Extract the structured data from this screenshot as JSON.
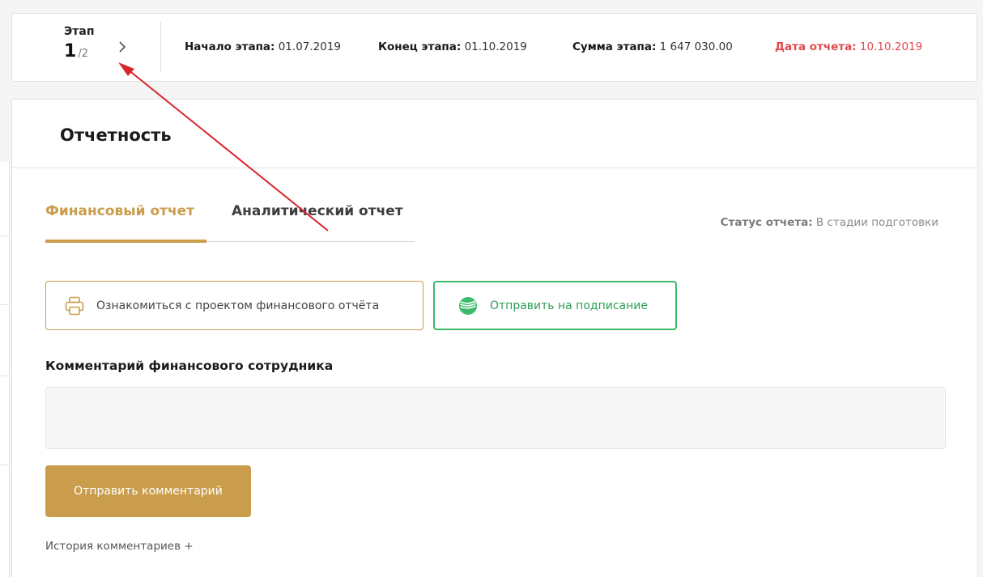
{
  "stage": {
    "label": "Этап",
    "current": "1",
    "total": "/2",
    "start_label": "Начало этапа:",
    "start_value": "01.07.2019",
    "end_label": "Конец этапа:",
    "end_value": "01.10.2019",
    "sum_label": "Сумма этапа:",
    "sum_value": "1 647 030.00",
    "report_date_label": "Дата отчета:",
    "report_date_value": "10.10.2019"
  },
  "reporting": {
    "title": "Отчетность",
    "tabs": [
      {
        "label": "Финансовый отчет",
        "active": true
      },
      {
        "label": "Аналитический отчет",
        "active": false
      }
    ],
    "status_label": "Статус отчета:",
    "status_value": "В стадии подготовки",
    "preview_button": "Ознакомиться с проектом финансового отчёта",
    "sign_button": "Отправить на подписание",
    "comment_label": "Комментарий финансового сотрудника",
    "comment_value": "",
    "send_button": "Отправить комментарий",
    "history_link": "История комментариев +"
  },
  "colors": {
    "accent": "#c99d4b",
    "danger": "#e0494e",
    "sber_green": "#3cba6a",
    "annotation_arrow": "#d9262b"
  },
  "icons": {
    "stage_next": "chevron-right-icon",
    "preview": "printer-icon",
    "sign": "sberbank-logo-icon"
  }
}
